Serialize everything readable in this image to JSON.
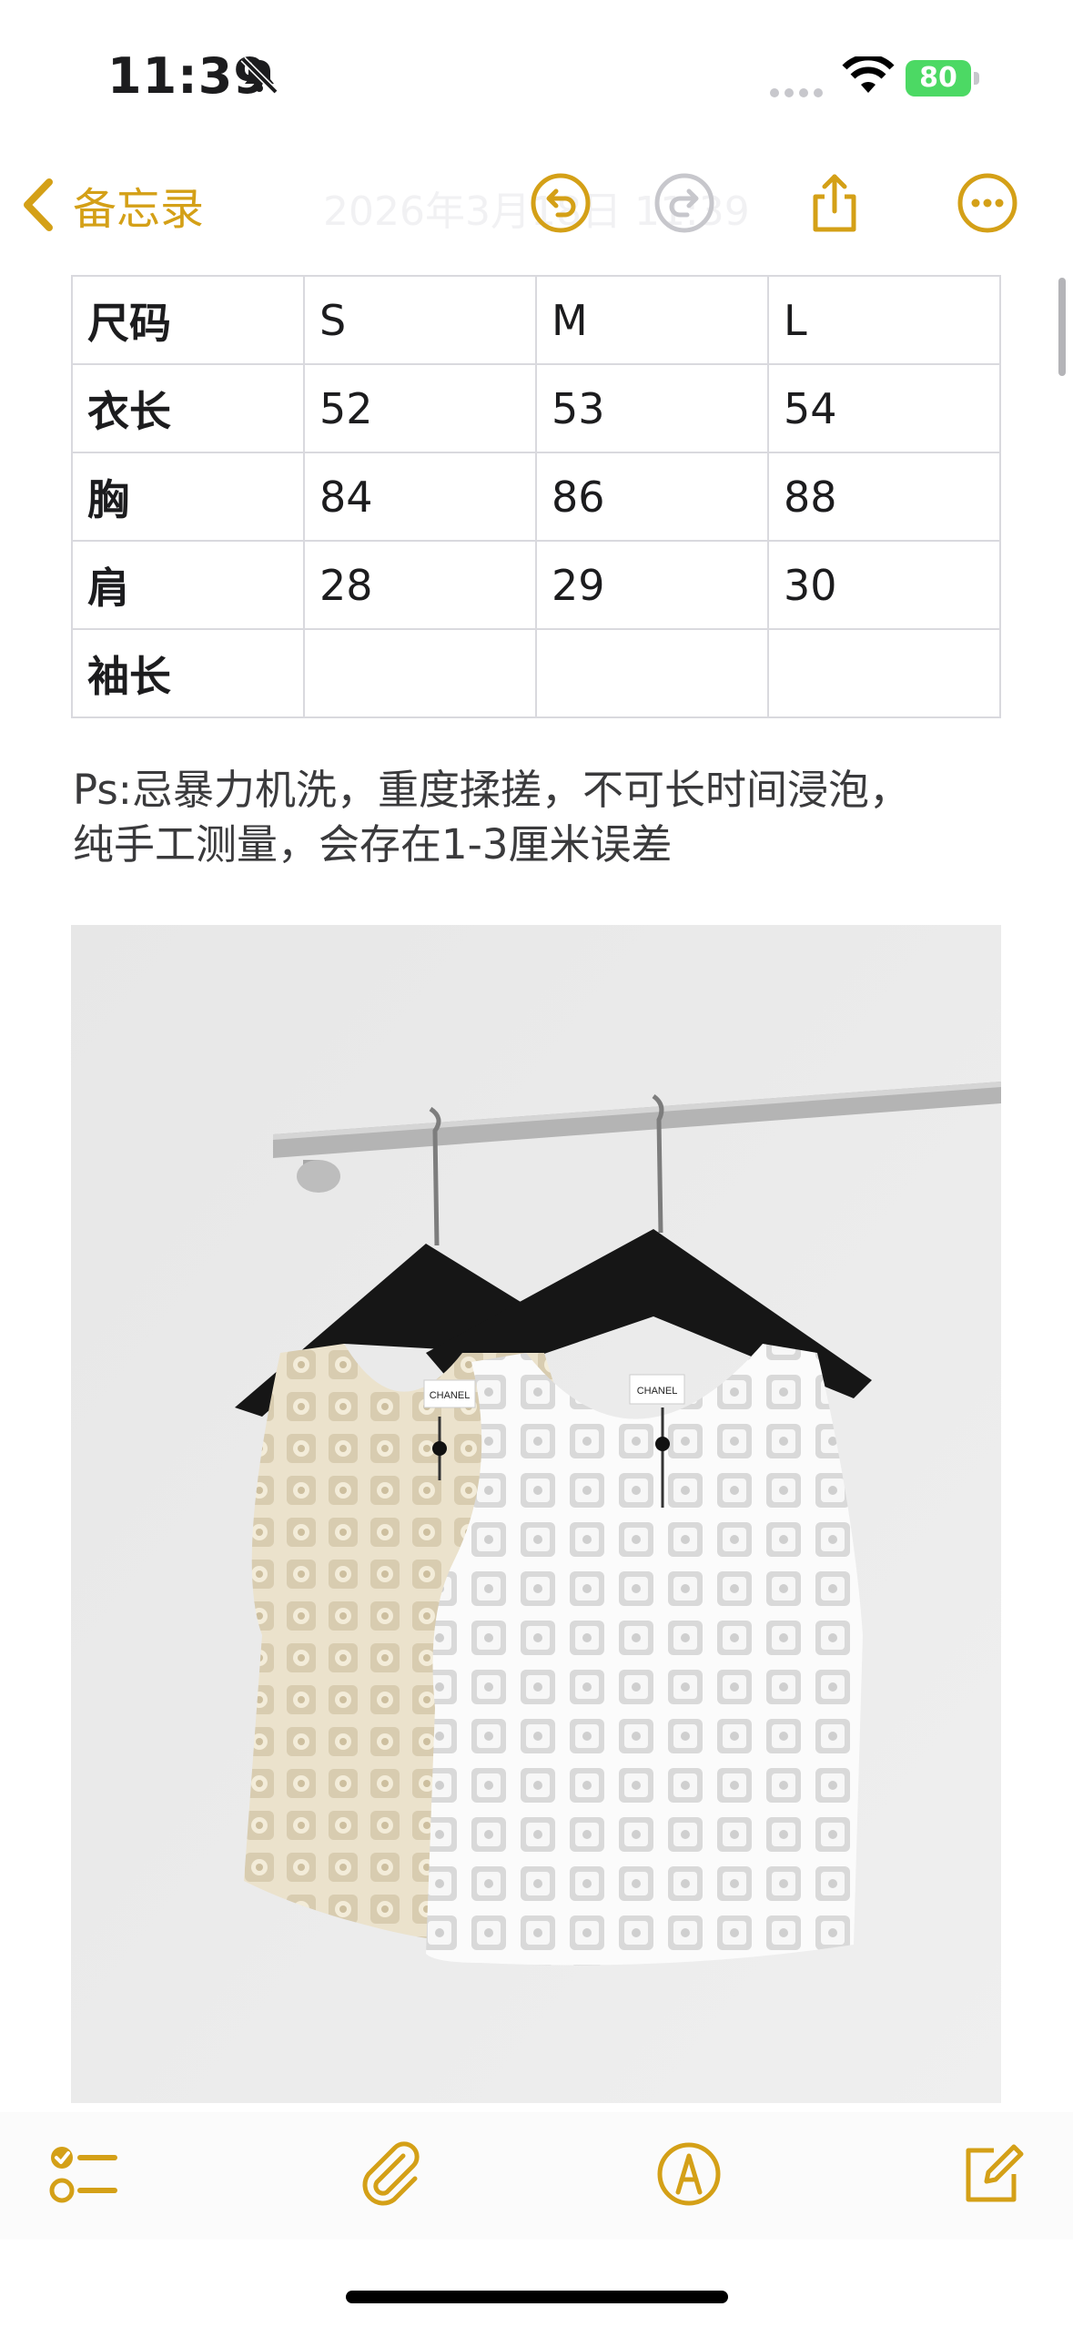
{
  "status_bar": {
    "time": "11:39",
    "battery": "80"
  },
  "nav": {
    "back_label": "备忘录",
    "ghost_title": "2026年3月18日 11:39"
  },
  "table": {
    "rows": [
      [
        "尺码",
        "S",
        "M",
        "L"
      ],
      [
        "衣长",
        "52",
        "53",
        "54"
      ],
      [
        "胸",
        "84",
        "86",
        "88"
      ],
      [
        "肩",
        "28",
        "29",
        "30"
      ],
      [
        "袖长",
        "",
        "",
        ""
      ]
    ]
  },
  "note": {
    "line1": "Ps:忌暴力机洗，重度揉搓，不可长时间浸泡，",
    "line2": "纯手工测量，会存在1-3厘米误差"
  },
  "photo": {
    "label_left": "CHANEL",
    "label_right": "CHANEL"
  },
  "colors": {
    "accent": "#d4a017",
    "battery": "#4cd964"
  }
}
